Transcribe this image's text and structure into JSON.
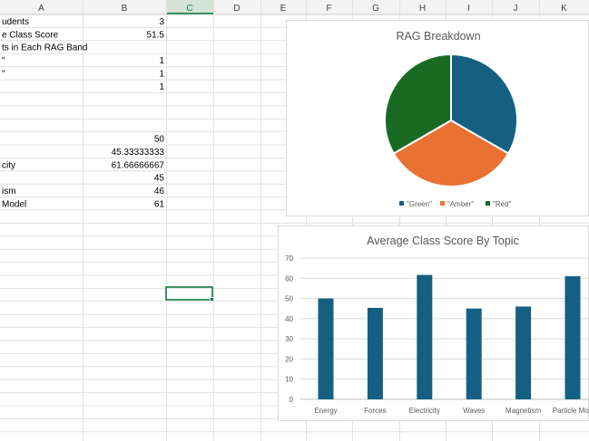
{
  "sheet": {
    "columns": [
      "A",
      "B",
      "C",
      "D",
      "E",
      "F",
      "G",
      "H",
      "I",
      "J",
      "K"
    ],
    "selected_column": "C",
    "rows": [
      {
        "a": "udents",
        "b": "3"
      },
      {
        "a": "e Class Score",
        "b": "51.5"
      },
      {
        "a": "ts in Each RAG Band",
        "b": ""
      },
      {
        "a": "\"",
        "b": "1"
      },
      {
        "a": "\"",
        "b": "1"
      },
      {
        "a": "",
        "b": "1"
      },
      {
        "a": "",
        "b": ""
      },
      {
        "a": "",
        "b": ""
      },
      {
        "a": "",
        "b": ""
      },
      {
        "a": "",
        "b": "50"
      },
      {
        "a": "",
        "b": "45.33333333"
      },
      {
        "a": "city",
        "b": "61.66666667"
      },
      {
        "a": "",
        "b": "45"
      },
      {
        "a": "ism",
        "b": "46"
      },
      {
        "a": " Model",
        "b": "61"
      }
    ]
  },
  "chart_data": [
    {
      "type": "pie",
      "title": "RAG Breakdown",
      "categories": [
        "\"Green\"",
        "\"Amber\"",
        "\"Red\""
      ],
      "values": [
        1,
        1,
        1
      ],
      "colors": [
        "#156082",
        "#e97132",
        "#196b24"
      ],
      "legend": "bottom"
    },
    {
      "type": "bar",
      "title": "Average Class Score By Topic",
      "categories": [
        "Energy",
        "Forces",
        "Electricity",
        "Waves",
        "Magnetism",
        "Particle Model"
      ],
      "category_labels": [
        "Energy",
        "Forces",
        "Electricity",
        "Waves",
        "Magnetism",
        "Particle Mod"
      ],
      "values": [
        50,
        45.33333333,
        61.66666667,
        45,
        46,
        61
      ],
      "ylim": [
        0,
        70
      ],
      "yticks": [
        0,
        10,
        20,
        30,
        40,
        50,
        60,
        70
      ],
      "color": "#156082",
      "grid": true
    }
  ]
}
